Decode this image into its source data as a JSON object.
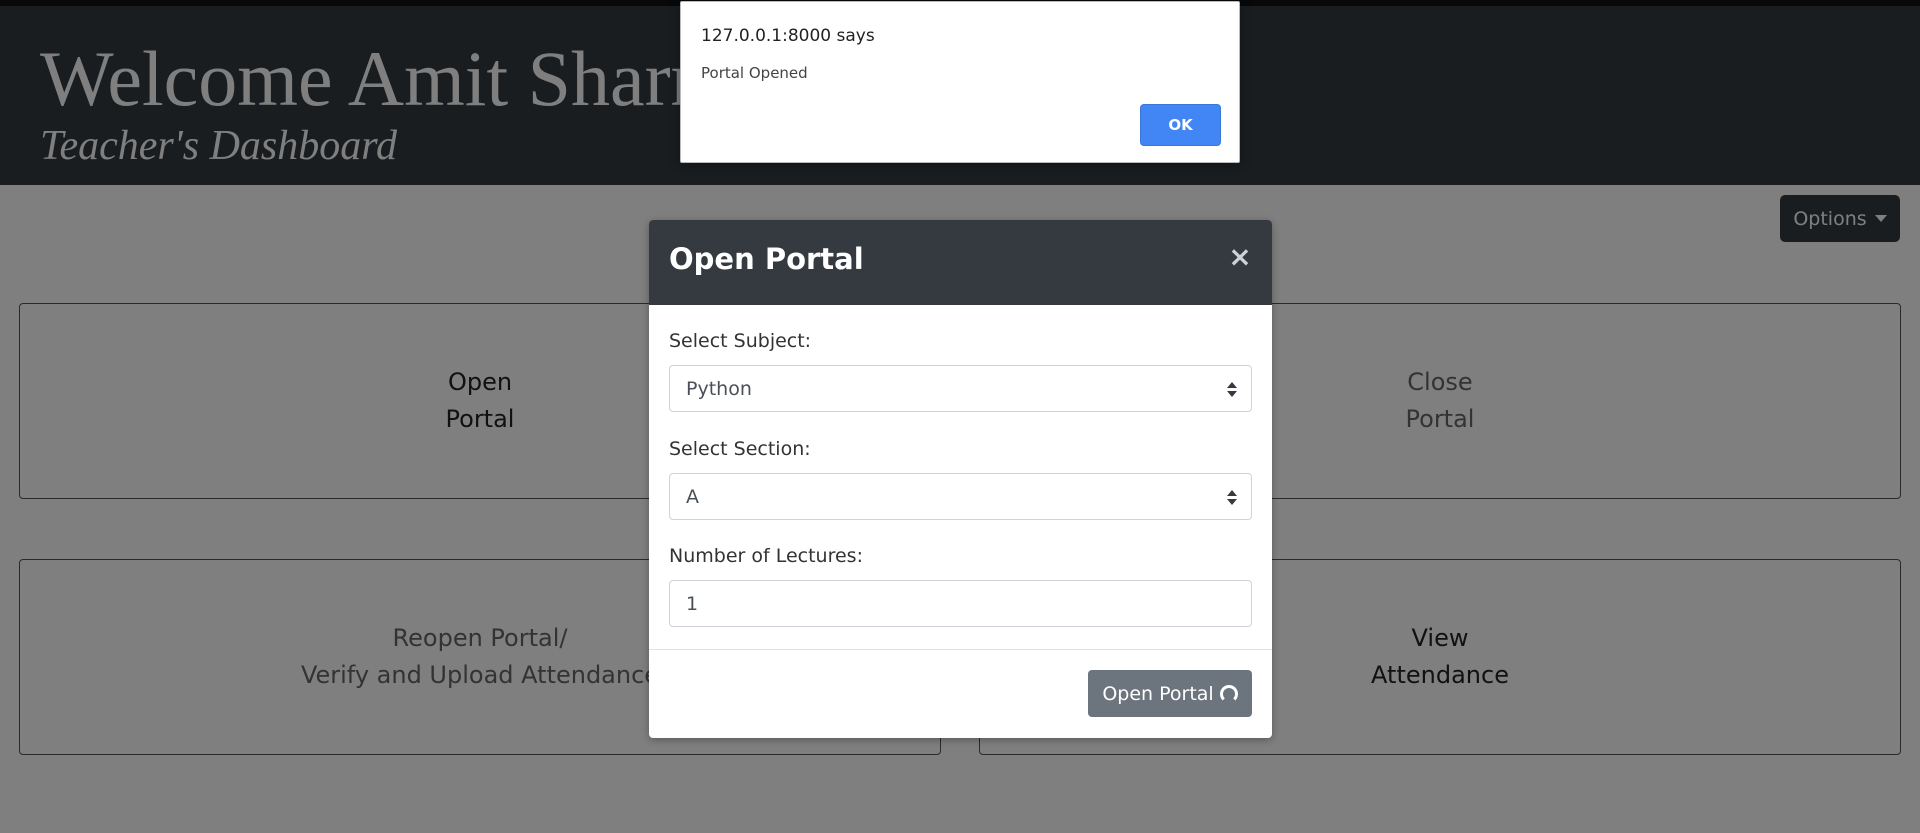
{
  "header": {
    "title": "Welcome Amit Sharma",
    "subtitle": "Teacher's Dashboard"
  },
  "toolbar": {
    "options_label": "Options"
  },
  "cards": {
    "open_portal": {
      "line1": "Open",
      "line2": "Portal"
    },
    "close_portal": {
      "line1": "Close",
      "line2": "Portal"
    },
    "reopen_portal": {
      "line1": "Reopen Portal/",
      "line2": "Verify and Upload Attendance"
    },
    "view_attendance": {
      "line1": "View",
      "line2": "Attendance"
    }
  },
  "modal": {
    "title": "Open Portal",
    "close_glyph": "×",
    "subject_label": "Select Subject:",
    "subject_value": "Python",
    "section_label": "Select Section:",
    "section_value": "A",
    "lectures_label": "Number of Lectures:",
    "lectures_value": "1",
    "submit_label": "Open Portal",
    "submit_icon": "spinner-icon"
  },
  "alert": {
    "origin": "127.0.0.1:8000 says",
    "message": "Portal Opened",
    "ok_label": "OK"
  },
  "colors": {
    "header_bg": "#343a40",
    "submit_bg": "#6c757d",
    "alert_ok_bg": "#4285f4"
  }
}
